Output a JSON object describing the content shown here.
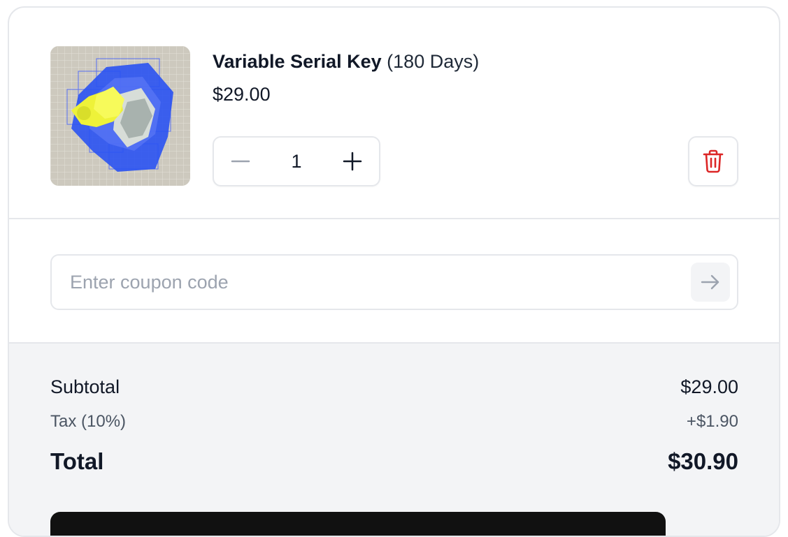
{
  "cart_item": {
    "name": "Variable Serial Key",
    "variant": "(180 Days)",
    "price": "$29.00",
    "quantity": "1",
    "thumbnail_icon": "product-thumbnail-image"
  },
  "coupon": {
    "value": "",
    "placeholder": "Enter coupon code",
    "submit_icon": "arrow-right-icon"
  },
  "summary": {
    "subtotal_label": "Subtotal",
    "subtotal_value": "$29.00",
    "tax_label": "Tax (10%)",
    "tax_value": "+$1.90",
    "total_label": "Total",
    "total_value": "$30.90"
  },
  "colors": {
    "delete_accent": "#dc2626",
    "checkout_button": "#111111",
    "summary_background": "#f3f4f6",
    "border": "#e5e7eb"
  }
}
